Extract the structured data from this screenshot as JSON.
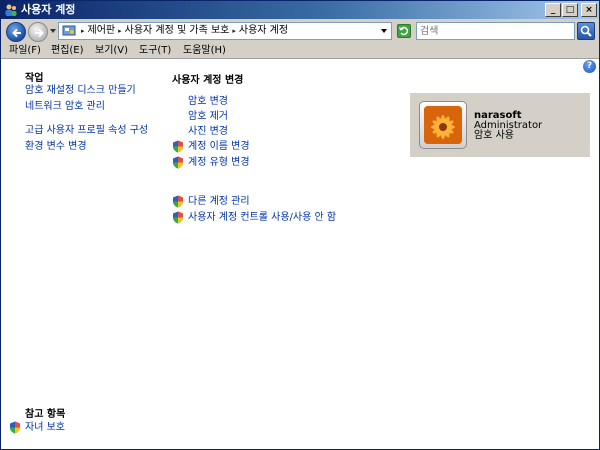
{
  "window": {
    "title": "사용자 계정",
    "buttons": {
      "minimize": "_",
      "maximize": "□",
      "close": "×"
    }
  },
  "address": {
    "crumbs": [
      "제어판",
      "사용자 계정 및 가족 보호",
      "사용자 계정"
    ],
    "search_placeholder": "검색"
  },
  "menu": [
    "파일(F)",
    "편집(E)",
    "보기(V)",
    "도구(T)",
    "도움말(H)"
  ],
  "help_label": "?",
  "tasks": {
    "title": "작업",
    "items": [
      "암호 재설정 디스크 만들기",
      "네트워크 암호 관리",
      "고급 사용자 프로필 속성 구성",
      "환경 변수 변경"
    ]
  },
  "change_account": {
    "title": "사용자 계정 변경",
    "items": [
      "암호 변경",
      "암호 제거",
      "사진 변경",
      "계정 이름 변경",
      "계정 유형 변경"
    ],
    "more_items": [
      "다른 계정 관리",
      "사용자 계정 컨트롤 사용/사용 안 함"
    ]
  },
  "account": {
    "name": "narasoft",
    "type": "Administrator",
    "status": "암호 사용"
  },
  "see_also": {
    "title": "참고 항목",
    "items": [
      "자녀 보호"
    ]
  },
  "colors": {
    "link": "#0033aa",
    "titlebar": "#0a246a",
    "card": "#d4d0c8"
  }
}
